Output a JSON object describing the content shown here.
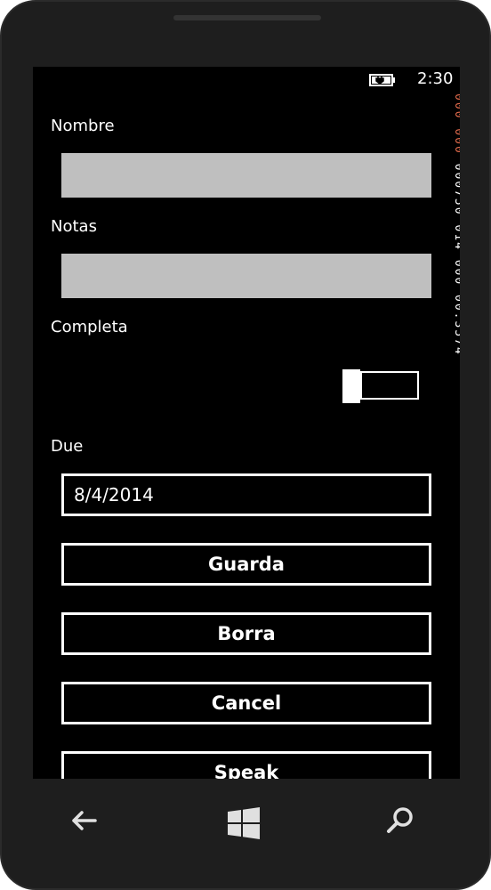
{
  "status_bar": {
    "time": "2:30",
    "battery_icon": "battery-charging-icon"
  },
  "form": {
    "nombre_label": "Nombre",
    "nombre_value": "",
    "notas_label": "Notas",
    "notas_value": "",
    "completa_label": "Completa",
    "completa_toggle": "off",
    "due_label": "Due",
    "due_value": "8/4/2014"
  },
  "buttons": {
    "guarda": "Guarda",
    "borra": "Borra",
    "cancel": "Cancel",
    "speak": "Speak"
  },
  "frame_counter": {
    "red_text": "000 000",
    "white_text": "000750 014 000 00.3574"
  },
  "nav_bar": {
    "back_icon": "back-arrow-icon",
    "start_icon": "windows-logo-icon",
    "search_icon": "search-icon"
  },
  "colors": {
    "screen_background": "#000000",
    "textbox_fill": "#bfbfbf",
    "foreground": "#ffffff",
    "counter_accent": "#e06a4c"
  }
}
